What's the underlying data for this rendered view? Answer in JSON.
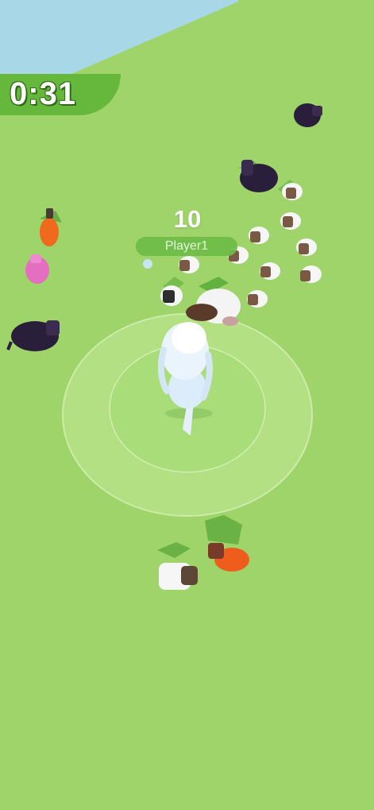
{
  "game": {
    "timer": "0:31",
    "player": {
      "name": "Player1",
      "score": "10"
    }
  },
  "icons": {
    "herd": [
      "sheep-icon",
      "cow-icon",
      "pig-icon",
      "rooster-icon"
    ],
    "player": "player-character-icon"
  },
  "colors": {
    "grass": "#9ed46a",
    "water": "#a8d8e8",
    "timer_panel": "#66b83d",
    "herd_ring": "#c9eb9f"
  }
}
